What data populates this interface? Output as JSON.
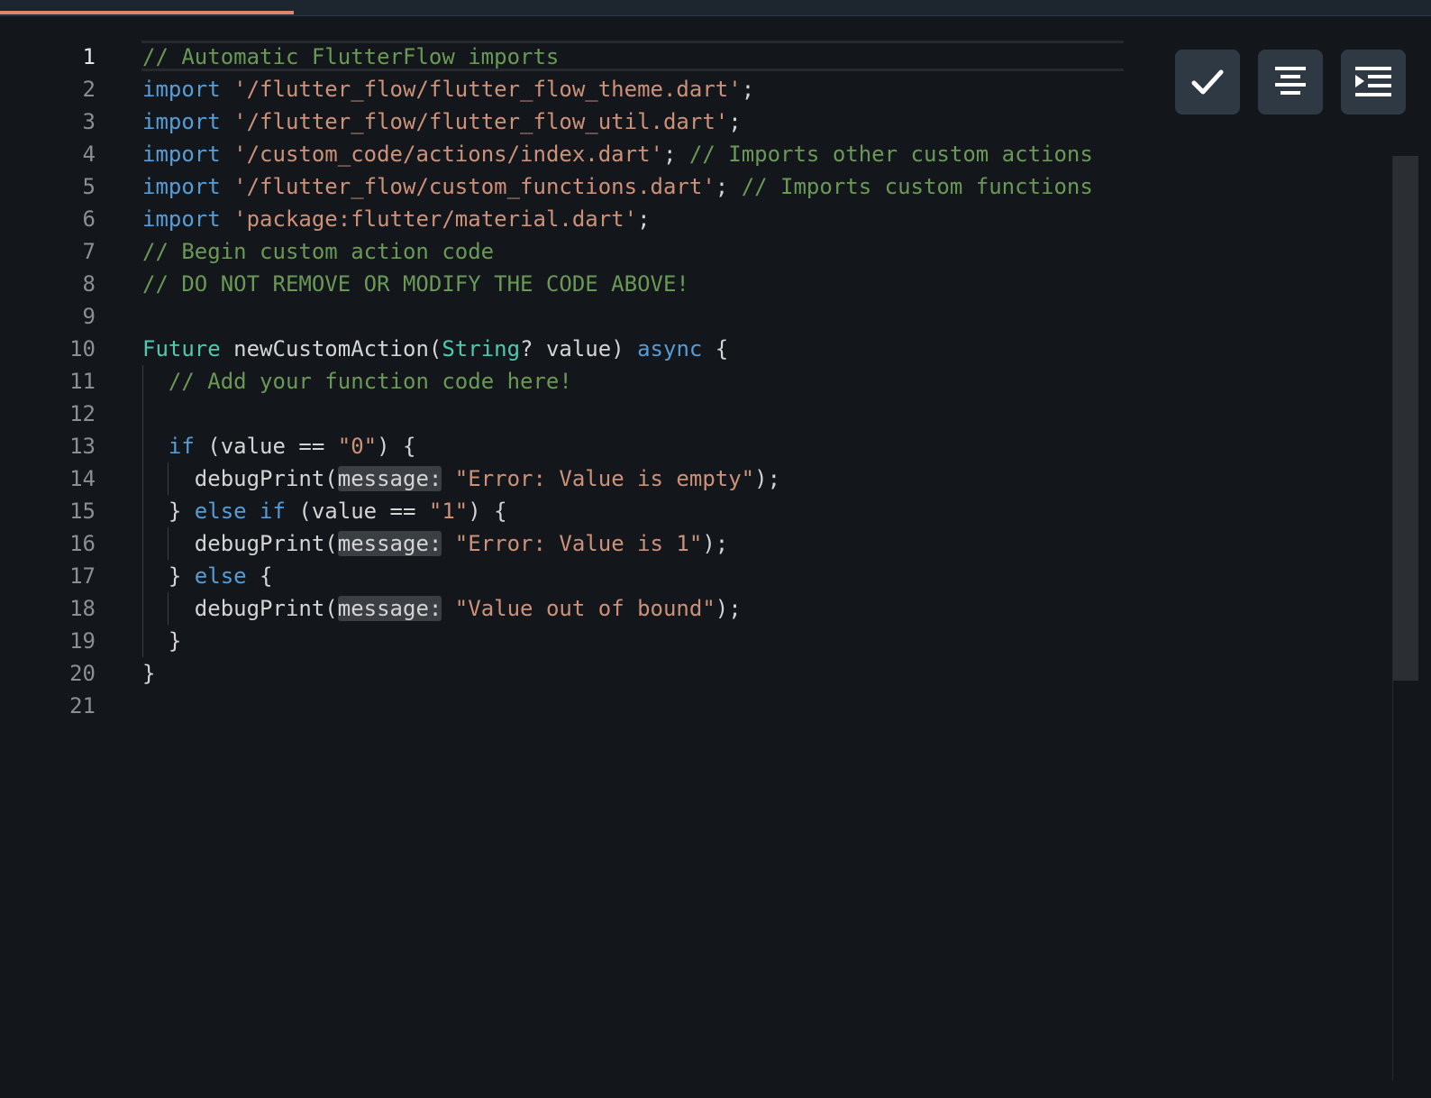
{
  "editor": {
    "active_line": 1,
    "lines": [
      {
        "n": "1",
        "indent": 0,
        "tokens": [
          {
            "t": "// Automatic FlutterFlow imports",
            "c": "cm"
          }
        ]
      },
      {
        "n": "2",
        "indent": 0,
        "tokens": [
          {
            "t": "import",
            "c": "kw"
          },
          {
            "t": " ",
            "c": "pl"
          },
          {
            "t": "'/flutter_flow/flutter_flow_theme.dart'",
            "c": "str"
          },
          {
            "t": ";",
            "c": "pl"
          }
        ]
      },
      {
        "n": "3",
        "indent": 0,
        "tokens": [
          {
            "t": "import",
            "c": "kw"
          },
          {
            "t": " ",
            "c": "pl"
          },
          {
            "t": "'/flutter_flow/flutter_flow_util.dart'",
            "c": "str"
          },
          {
            "t": ";",
            "c": "pl"
          }
        ]
      },
      {
        "n": "4",
        "indent": 0,
        "tokens": [
          {
            "t": "import",
            "c": "kw"
          },
          {
            "t": " ",
            "c": "pl"
          },
          {
            "t": "'/custom_code/actions/index.dart'",
            "c": "str"
          },
          {
            "t": "; ",
            "c": "pl"
          },
          {
            "t": "// Imports other custom actions",
            "c": "cm"
          }
        ]
      },
      {
        "n": "5",
        "indent": 0,
        "tokens": [
          {
            "t": "import",
            "c": "kw"
          },
          {
            "t": " ",
            "c": "pl"
          },
          {
            "t": "'/flutter_flow/custom_functions.dart'",
            "c": "str"
          },
          {
            "t": "; ",
            "c": "pl"
          },
          {
            "t": "// Imports custom functions",
            "c": "cm"
          }
        ]
      },
      {
        "n": "6",
        "indent": 0,
        "tokens": [
          {
            "t": "import",
            "c": "kw"
          },
          {
            "t": " ",
            "c": "pl"
          },
          {
            "t": "'package:flutter/material.dart'",
            "c": "str"
          },
          {
            "t": ";",
            "c": "pl"
          }
        ]
      },
      {
        "n": "7",
        "indent": 0,
        "tokens": [
          {
            "t": "// Begin custom action code",
            "c": "cm"
          }
        ]
      },
      {
        "n": "8",
        "indent": 0,
        "tokens": [
          {
            "t": "// DO NOT REMOVE OR MODIFY THE CODE ABOVE!",
            "c": "cm"
          }
        ]
      },
      {
        "n": "9",
        "indent": 0,
        "tokens": []
      },
      {
        "n": "10",
        "indent": 0,
        "tokens": [
          {
            "t": "Future",
            "c": "ty"
          },
          {
            "t": " newCustomAction(",
            "c": "pl"
          },
          {
            "t": "String",
            "c": "ty"
          },
          {
            "t": "? value) ",
            "c": "pl"
          },
          {
            "t": "async",
            "c": "kw"
          },
          {
            "t": " {",
            "c": "pl"
          }
        ]
      },
      {
        "n": "11",
        "indent": 1,
        "tokens": [
          {
            "t": "  ",
            "c": "pl"
          },
          {
            "t": "// Add your function code here!",
            "c": "cm"
          }
        ]
      },
      {
        "n": "12",
        "indent": 1,
        "tokens": []
      },
      {
        "n": "13",
        "indent": 1,
        "tokens": [
          {
            "t": "  ",
            "c": "pl"
          },
          {
            "t": "if",
            "c": "kw"
          },
          {
            "t": " (value == ",
            "c": "pl"
          },
          {
            "t": "\"0\"",
            "c": "str"
          },
          {
            "t": ") {",
            "c": "pl"
          }
        ]
      },
      {
        "n": "14",
        "indent": 2,
        "tokens": [
          {
            "t": "    debugPrint(",
            "c": "pl"
          },
          {
            "t": "message:",
            "c": "hint"
          },
          {
            "t": " ",
            "c": "pl"
          },
          {
            "t": "\"Error: Value is empty\"",
            "c": "str"
          },
          {
            "t": ");",
            "c": "pl"
          }
        ]
      },
      {
        "n": "15",
        "indent": 1,
        "tokens": [
          {
            "t": "  } ",
            "c": "pl"
          },
          {
            "t": "else",
            "c": "kw"
          },
          {
            "t": " ",
            "c": "pl"
          },
          {
            "t": "if",
            "c": "kw"
          },
          {
            "t": " (value == ",
            "c": "pl"
          },
          {
            "t": "\"1\"",
            "c": "str"
          },
          {
            "t": ") {",
            "c": "pl"
          }
        ]
      },
      {
        "n": "16",
        "indent": 2,
        "tokens": [
          {
            "t": "    debugPrint(",
            "c": "pl"
          },
          {
            "t": "message:",
            "c": "hint"
          },
          {
            "t": " ",
            "c": "pl"
          },
          {
            "t": "\"Error: Value is 1\"",
            "c": "str"
          },
          {
            "t": ");",
            "c": "pl"
          }
        ]
      },
      {
        "n": "17",
        "indent": 1,
        "tokens": [
          {
            "t": "  } ",
            "c": "pl"
          },
          {
            "t": "else",
            "c": "kw"
          },
          {
            "t": " {",
            "c": "pl"
          }
        ]
      },
      {
        "n": "18",
        "indent": 2,
        "tokens": [
          {
            "t": "    debugPrint(",
            "c": "pl"
          },
          {
            "t": "message:",
            "c": "hint"
          },
          {
            "t": " ",
            "c": "pl"
          },
          {
            "t": "\"Value out of bound\"",
            "c": "str"
          },
          {
            "t": ");",
            "c": "pl"
          }
        ]
      },
      {
        "n": "19",
        "indent": 1,
        "tokens": [
          {
            "t": "  }",
            "c": "pl"
          }
        ]
      },
      {
        "n": "20",
        "indent": 0,
        "tokens": [
          {
            "t": "}",
            "c": "pl"
          }
        ]
      },
      {
        "n": "21",
        "indent": 0,
        "tokens": []
      }
    ]
  },
  "toolbar": {
    "buttons": [
      {
        "name": "check-button",
        "icon": "check-icon"
      },
      {
        "name": "format-button",
        "icon": "align-center-icon"
      },
      {
        "name": "indent-button",
        "icon": "indent-icon"
      }
    ]
  },
  "colors": {
    "background": "#13171b",
    "keyword": "#569cd6",
    "string": "#ce9178",
    "comment": "#6a9955",
    "type": "#4ec9b0",
    "progress": "#e0876a",
    "button_bg": "#2f3944"
  }
}
